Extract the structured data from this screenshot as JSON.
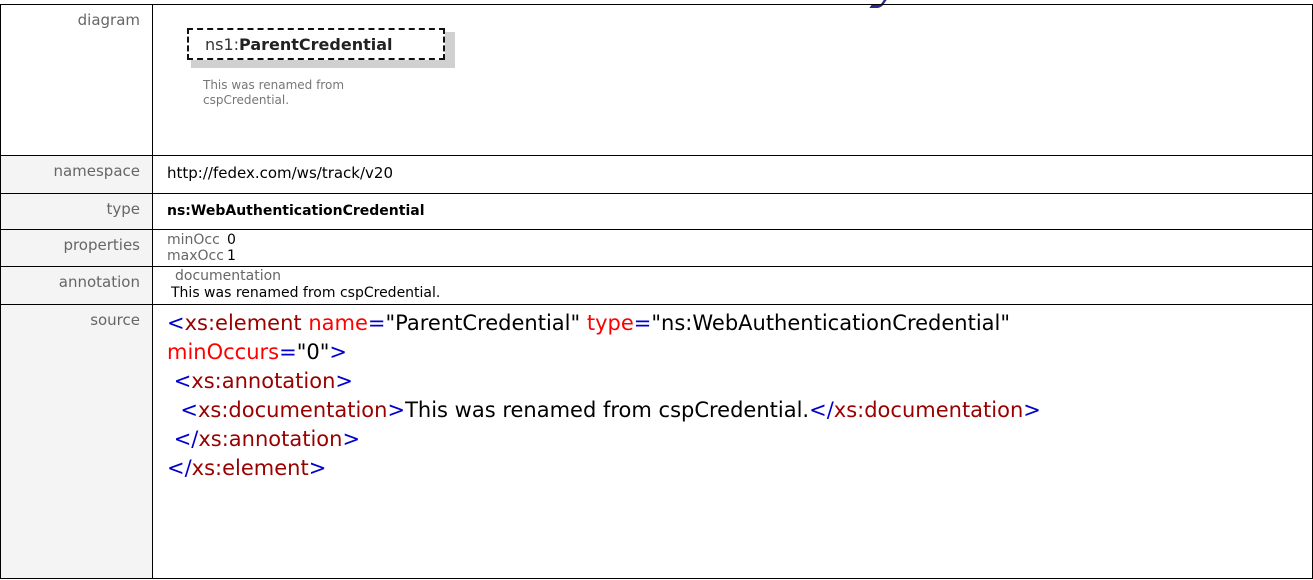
{
  "rows": {
    "diagram": {
      "label": "diagram",
      "prefix": "ns1:",
      "name": "ParentCredential",
      "note_line1": "This was renamed from",
      "note_line2": "cspCredential."
    },
    "namespace": {
      "label": "namespace",
      "value": "http://fedex.com/ws/track/v20"
    },
    "type": {
      "label": "type",
      "value": "ns:WebAuthenticationCredential"
    },
    "properties": {
      "label": "properties",
      "items": [
        {
          "key": "minOcc",
          "value": "0"
        },
        {
          "key": "maxOcc",
          "value": "1"
        }
      ]
    },
    "annotation": {
      "label": "annotation",
      "heading": "documentation",
      "text": "This was renamed from cspCredential."
    },
    "source": {
      "label": "source",
      "line1": {
        "open": "<",
        "tag": "xs:element",
        "attr1": "name",
        "val1": "\"ParentCredential\"",
        "attr2": "type",
        "val2": "\"ns:WebAuthenticationCredential\"",
        "eq": "="
      },
      "line2": {
        "attr": "minOccurs",
        "eq": "=",
        "val": "\"0\"",
        "close": ">"
      },
      "line3": {
        "open": "<",
        "tag": "xs:annotation",
        "close": ">"
      },
      "line4": {
        "open": "<",
        "tag": "xs:documentation",
        "close": ">",
        "text": "This was renamed from cspCredential.",
        "end_open": "</",
        "end_tag": "xs:documentation",
        "end_close": ">"
      },
      "line5": {
        "open": "</",
        "tag": "xs:annotation",
        "close": ">"
      },
      "line6": {
        "open": "</",
        "tag": "xs:element",
        "close": ">"
      }
    }
  },
  "colors": {
    "markup": "#0000cc",
    "element_name": "#990000",
    "attribute": "#ff0000",
    "label": "#666666"
  }
}
